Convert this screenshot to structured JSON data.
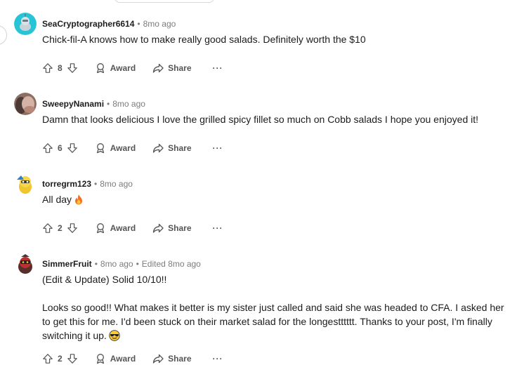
{
  "comments": [
    {
      "author": "SeaCryptographer6614",
      "time": "8mo ago",
      "edited": "",
      "body": [
        "Chick-fil-A knows how to make really good salads. Definitely worth the $10"
      ],
      "votes": "8",
      "avatar": "robot-avatar-cyan"
    },
    {
      "author": "SweepyNanami",
      "time": "8mo ago",
      "edited": "",
      "body": [
        "Damn that looks delicious I love the grilled spicy fillet so much on Cobb salads I hope you enjoyed it!"
      ],
      "votes": "6",
      "avatar": "photo-avatar"
    },
    {
      "author": "torregrm123",
      "time": "8mo ago",
      "edited": "",
      "body": [
        "All day"
      ],
      "votes": "2",
      "avatar": "snoo-avatar-yellow"
    },
    {
      "author": "SimmerFruit",
      "time": "8mo ago",
      "edited": "Edited 8mo ago",
      "body": [
        "(Edit & Update) Solid 10/10!!",
        "Looks so good!! What makes it better is my sister just called and said she was headed to CFA. I asked her to get this for me. I'd been stuck on their market salad for the longestttttt. Thanks to your post, I'm finally switching it up."
      ],
      "votes": "2",
      "avatar": "snoo-avatar-dark"
    }
  ],
  "actions": {
    "award": "Award",
    "share": "Share",
    "more": "···"
  },
  "separator": "•",
  "icons": {
    "upvote": "upvote-icon",
    "downvote": "downvote-icon",
    "award": "award-icon",
    "share": "share-icon",
    "fire": "fire-emoji",
    "sunglasses": "sunglasses-emoji"
  }
}
